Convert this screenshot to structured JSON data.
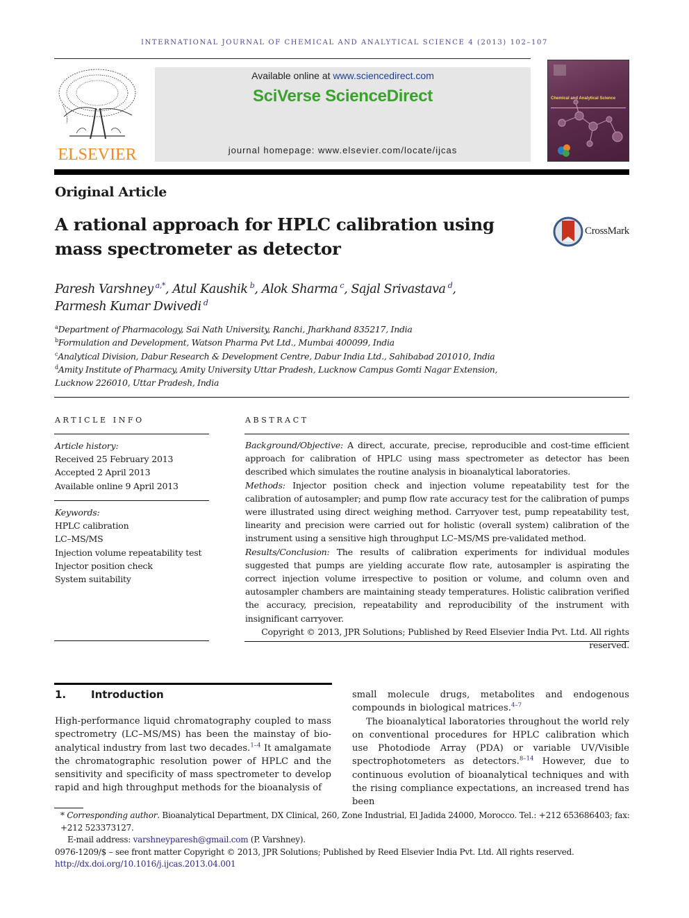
{
  "running_head": "International Journal of Chemical and Analytical Science 4 (2013) 102–107",
  "masthead": {
    "publisher_logo_text": "ELSEVIER",
    "available_online_prefix": "Available online at ",
    "available_online_link": "www.sciencedirect.com",
    "platform_brand": "SciVerse ScienceDirect",
    "journal_homepage": "journal homepage: www.elsevier.com/locate/ijcas",
    "cover_title": "Chemical and Analytical Science",
    "colors": {
      "elsevier_orange": "#f08a24",
      "sciencedirect_green": "#3aa12c",
      "band_gray": "#e6e6e6",
      "link_blue": "#2a2a8c",
      "cover_purple": "#5e2e4c"
    }
  },
  "article": {
    "type": "Original Article",
    "title": "A rational approach for HPLC calibration using mass spectrometer as detector",
    "crossmark_label": "CrossMark",
    "authors": [
      {
        "name": "Paresh Varshney",
        "affil": "a,*",
        "sep": ", "
      },
      {
        "name": "Atul Kaushik",
        "affil": "b",
        "sep": ", "
      },
      {
        "name": "Alok Sharma",
        "affil": "c",
        "sep": ", "
      },
      {
        "name": "Sajal Srivastava",
        "affil": "d",
        "sep": ","
      },
      {
        "name": "Parmesh Kumar Dwivedi",
        "affil": "d",
        "sep": ""
      }
    ],
    "affiliations": [
      {
        "key": "a",
        "text": "Department of Pharmacology, Sai Nath University, Ranchi, Jharkhand 835217, India"
      },
      {
        "key": "b",
        "text": "Formulation and Development, Watson Pharma Pvt Ltd., Mumbai 400099, India"
      },
      {
        "key": "c",
        "text": "Analytical Division, Dabur Research & Development Centre, Dabur India Ltd., Sahibabad 201010, India"
      },
      {
        "key": "d",
        "text": "Amity Institute of Pharmacy, Amity University Uttar Pradesh, Lucknow Campus Gomti Nagar Extension, Lucknow 226010, Uttar Pradesh, India"
      }
    ]
  },
  "article_info": {
    "label": "ARTICLE INFO",
    "history_title": "Article history:",
    "history": [
      "Received 25 February 2013",
      "Accepted 2 April 2013",
      "Available online 9 April 2013"
    ],
    "keywords_title": "Keywords:",
    "keywords": [
      "HPLC calibration",
      "LC–MS/MS",
      "Injection volume repeatability test",
      "Injector position check",
      "System suitability"
    ]
  },
  "abstract": {
    "label": "ABSTRACT",
    "sections": [
      {
        "head": "Background/Objective:",
        "text": " A direct, accurate, precise, reproducible and cost-time efficient approach for calibration of HPLC using mass spectrometer as detector has been described which simulates the routine analysis in bioanalytical laboratories."
      },
      {
        "head": "Methods:",
        "text": " Injector position check and injection volume repeatability test for the calibration of autosampler; and pump flow rate accuracy test for the calibration of pumps were illustrated using direct weighing method. Carryover test, pump repeatability test, linearity and precision were carried out for holistic (overall system) calibration of the instrument using a sensitive high throughput LC–MS/MS pre-validated method."
      },
      {
        "head": "Results/Conclusion:",
        "text": " The results of calibration experiments for individual modules suggested that pumps are yielding accurate flow rate, autosampler is aspirating the correct injection volume irrespective to position or volume, and column oven and autosampler chambers are maintaining steady temperatures. Holistic calibration verified the accuracy, precision, repeatability and reproducibility of the instrument with insignificant carryover."
      }
    ],
    "copyright": "Copyright © 2013, JPR Solutions; Published by Reed Elsevier India Pvt. Ltd. All rights reserved."
  },
  "introduction": {
    "number": "1.",
    "heading": "Introduction",
    "left_p1_a": "High-performance liquid chromatography coupled to mass spectrometry (LC–MS/MS) has been the mainstay of bio-analytical industry from last two decades.",
    "left_p1_ref": "1–4",
    "left_p1_b": " It amalgamate the chromatographic resolution power of HPLC and the sensitivity and specificity of mass spectrometer to develop rapid and high throughput methods for the bioanalysis of",
    "right_p1_a": "small molecule drugs, metabolites and endogenous compounds in biological matrices.",
    "right_p1_ref": "4–7",
    "right_p2_a": "The bioanalytical laboratories throughout the world rely on conventional procedures for HPLC calibration which use Photodiode Array (PDA) or variable UV/Visible spectrophotometers as detectors.",
    "right_p2_ref": "8–14",
    "right_p2_b": " However, due to continuous evolution of bioanalytical techniques and with the rising compliance expectations, an increased trend has been"
  },
  "footnotes": {
    "star": "*",
    "corresponding_label": "Corresponding author",
    "corresponding_text": ". Bioanalytical Department, DX Clinical, 260, Zone Industrial, El Jadida 24000, Morocco. Tel.: +212 653686403; fax: +212 523373127.",
    "email_label": "E-mail address: ",
    "email": "varshneyparesh@gmail.com",
    "email_suffix": " (P. Varshney).",
    "issn_line": "0976-1209/$ – see front matter Copyright © 2013, JPR Solutions; Published by Reed Elsevier India Pvt. Ltd. All rights reserved.",
    "doi": "http://dx.doi.org/10.1016/j.ijcas.2013.04.001"
  }
}
